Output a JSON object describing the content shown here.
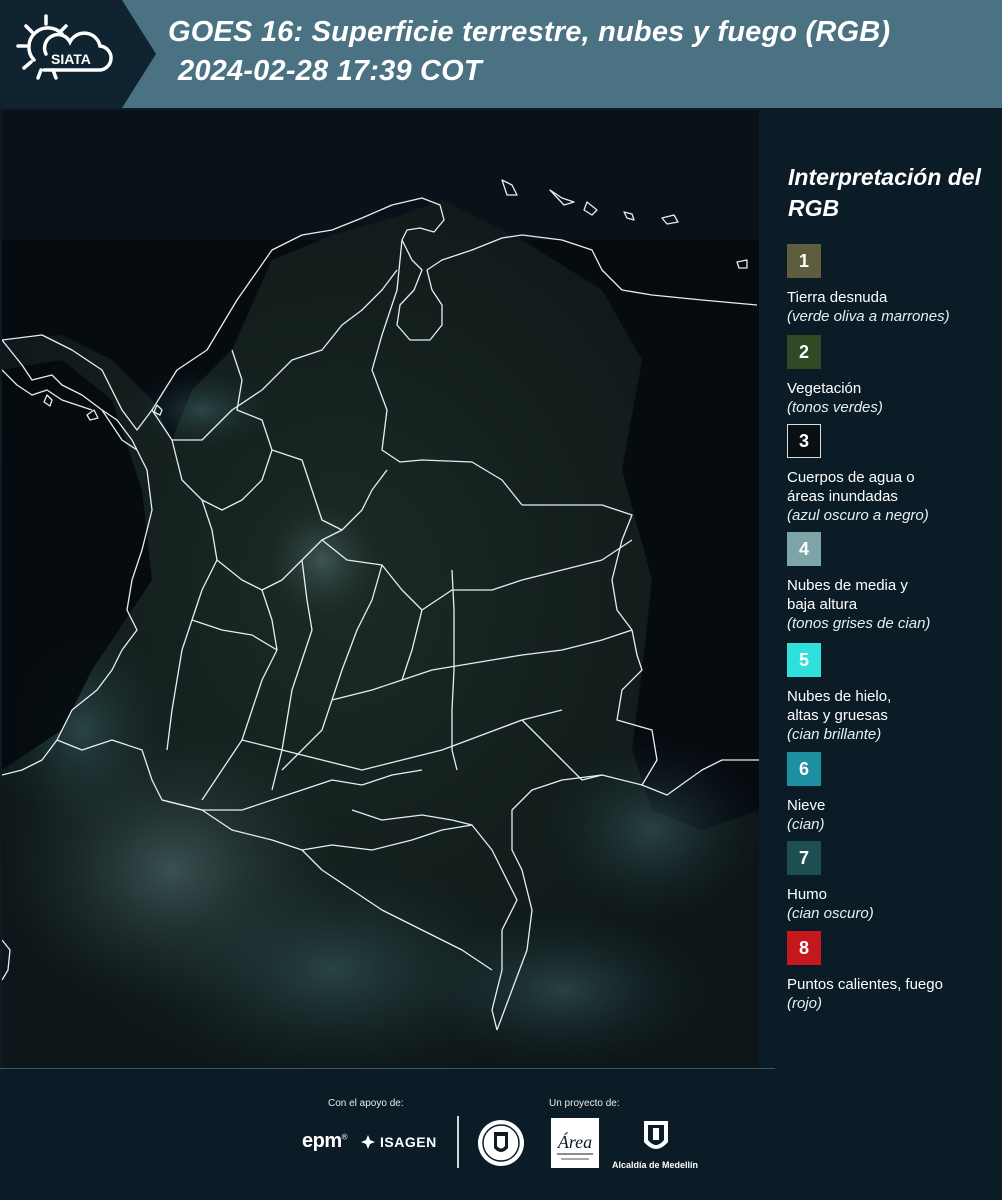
{
  "header": {
    "brand": "SIATA",
    "title_line1": "GOES 16: Superficie terrestre, nubes y fuego (RGB)",
    "title_line2": "2024-02-28 17:39 COT"
  },
  "legend": {
    "title": "Interpretación del RGB",
    "items": [
      {
        "number": "1",
        "label": "Tierra desnuda",
        "sub": "(verde oliva a marrones)",
        "color": "#5e5d3f"
      },
      {
        "number": "2",
        "label": "Vegetación",
        "sub": "(tonos verdes)",
        "color": "#2f4a25"
      },
      {
        "number": "3",
        "label": "Cuerpos de agua o áreas inundadas",
        "sub": "(azul oscuro a negro)",
        "color": "#0a0f14"
      },
      {
        "number": "4",
        "label": "Nubes de media y baja altura",
        "sub": "(tonos grises de cian)",
        "color": "#7da4a6"
      },
      {
        "number": "5",
        "label": "Nubes de hielo, altas y gruesas",
        "sub": "(cian brillante)",
        "color": "#2fe0dc"
      },
      {
        "number": "6",
        "label": "Nieve",
        "sub": "(cian)",
        "color": "#1e8ea2"
      },
      {
        "number": "7",
        "label": "Humo",
        "sub": "(cian oscuro)",
        "color": "#1d4f52"
      },
      {
        "number": "8",
        "label": "Puntos calientes, fuego",
        "sub": "(rojo)",
        "color": "#c3191d"
      }
    ]
  },
  "footer": {
    "support_label": "Con el apoyo de:",
    "project_label": "Un proyecto de:",
    "epm": "epm",
    "isagen": "ISAGEN",
    "area_metropolitana": "Área",
    "alcaldia": "Alcaldía de Medellín"
  }
}
